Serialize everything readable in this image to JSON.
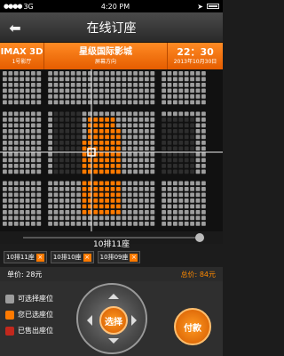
{
  "status": {
    "carrier_signal": "●●●●",
    "network": "3G",
    "time": "4:20 PM"
  },
  "header": {
    "title": "在线订座",
    "back_icon": "arrow-left-icon"
  },
  "info": {
    "format": "IMAX 3D",
    "hall": "1号影厅",
    "cinema": "星级国际影城",
    "screen_direction": "屏幕方向",
    "time": "22：30",
    "date": "2013年10月30日"
  },
  "seat_map": {
    "selected_seat_label": "10排11座"
  },
  "chosen": [
    {
      "label": "10排11座"
    },
    {
      "label": "10排10座"
    },
    {
      "label": "10排09座"
    }
  ],
  "price": {
    "unit_label": "单价:",
    "unit_value": "28元",
    "total_label": "总价:",
    "total_value": "84元"
  },
  "legend": [
    {
      "label": "可选择座位",
      "color": "#9d9d9d"
    },
    {
      "label": "您已选座位",
      "color": "#ff7a00"
    },
    {
      "label": "已售出座位",
      "color": "#c2281d"
    }
  ],
  "controls": {
    "select_label": "选择",
    "pay_label": "付款"
  }
}
